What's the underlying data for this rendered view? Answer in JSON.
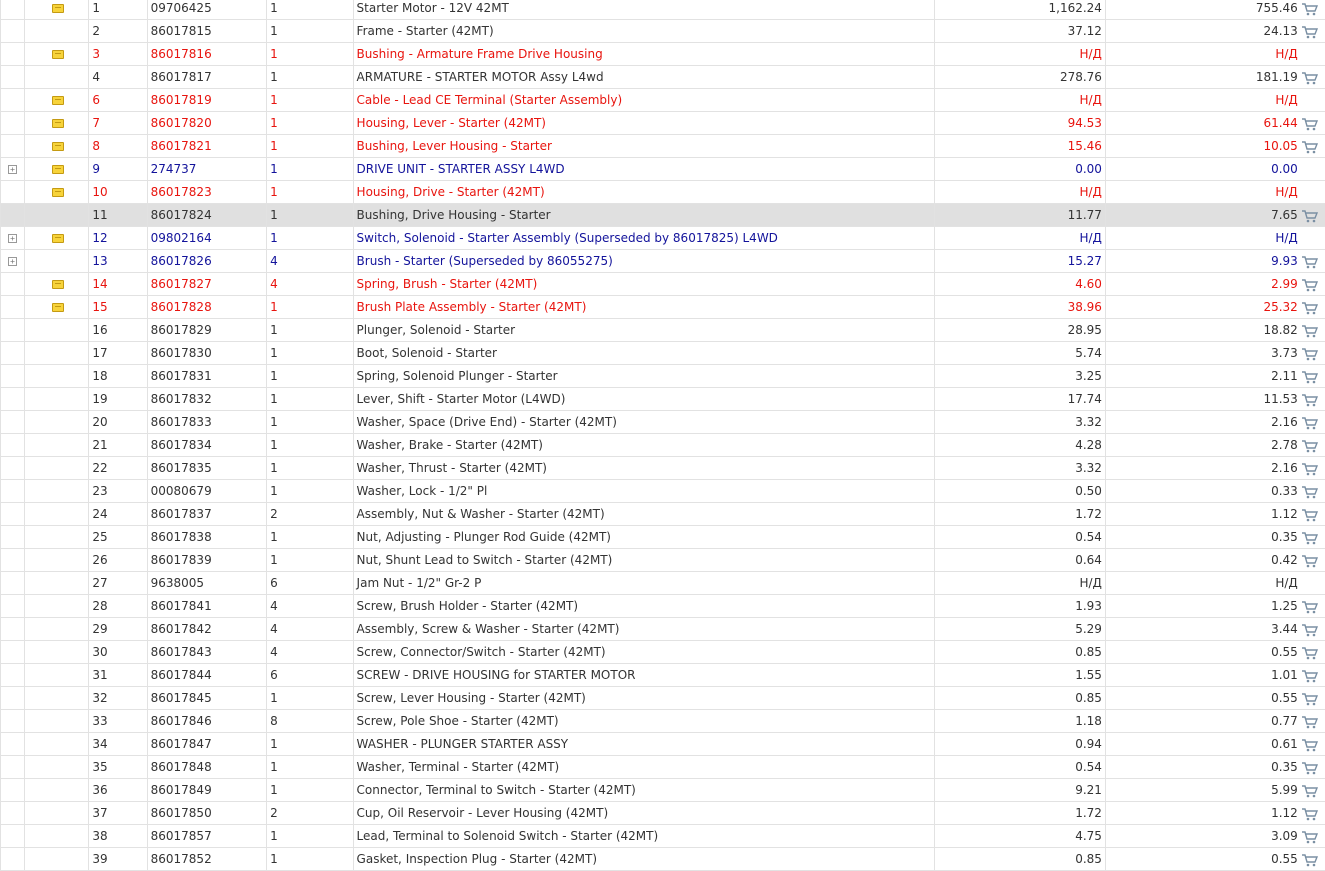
{
  "icons": {
    "note": "note-icon",
    "expand": "expand-plus-icon",
    "cart": "cart-icon"
  },
  "colors": {
    "red": "#e8140e",
    "blue": "#13139b",
    "highlight": "#e0e0e0"
  },
  "rows": [
    {
      "num": "1",
      "code": "09706425",
      "qty": "1",
      "desc": "Starter Motor - 12V 42MT",
      "price1": "1,162.24",
      "price2": "755.46",
      "note": true,
      "expand": false,
      "cart": true,
      "style": ""
    },
    {
      "num": "2",
      "code": "86017815",
      "qty": "1",
      "desc": "Frame - Starter (42MT)",
      "price1": "37.12",
      "price2": "24.13",
      "note": false,
      "expand": false,
      "cart": true,
      "style": ""
    },
    {
      "num": "3",
      "code": "86017816",
      "qty": "1",
      "desc": "Bushing - Armature Frame Drive Housing",
      "price1": "Н/Д",
      "price2": "Н/Д",
      "note": true,
      "expand": false,
      "cart": false,
      "style": "red"
    },
    {
      "num": "4",
      "code": "86017817",
      "qty": "1",
      "desc": "ARMATURE - STARTER MOTOR Assy L4wd",
      "price1": "278.76",
      "price2": "181.19",
      "note": false,
      "expand": false,
      "cart": true,
      "style": ""
    },
    {
      "num": "6",
      "code": "86017819",
      "qty": "1",
      "desc": "Cable - Lead CE Terminal (Starter Assembly)",
      "price1": "Н/Д",
      "price2": "Н/Д",
      "note": true,
      "expand": false,
      "cart": false,
      "style": "red"
    },
    {
      "num": "7",
      "code": "86017820",
      "qty": "1",
      "desc": "Housing, Lever - Starter (42MT)",
      "price1": "94.53",
      "price2": "61.44",
      "note": true,
      "expand": false,
      "cart": true,
      "style": "red"
    },
    {
      "num": "8",
      "code": "86017821",
      "qty": "1",
      "desc": "Bushing, Lever Housing - Starter",
      "price1": "15.46",
      "price2": "10.05",
      "note": true,
      "expand": false,
      "cart": true,
      "style": "red"
    },
    {
      "num": "9",
      "code": "274737",
      "qty": "1",
      "desc": "DRIVE UNIT - STARTER ASSY L4WD",
      "price1": "0.00",
      "price2": "0.00",
      "note": true,
      "expand": true,
      "cart": false,
      "style": "blue"
    },
    {
      "num": "10",
      "code": "86017823",
      "qty": "1",
      "desc": "Housing, Drive - Starter (42MT)",
      "price1": "Н/Д",
      "price2": "Н/Д",
      "note": true,
      "expand": false,
      "cart": false,
      "style": "red"
    },
    {
      "num": "11",
      "code": "86017824",
      "qty": "1",
      "desc": "Bushing, Drive Housing - Starter",
      "price1": "11.77",
      "price2": "7.65",
      "note": false,
      "expand": false,
      "cart": true,
      "style": "hl"
    },
    {
      "num": "12",
      "code": "09802164",
      "qty": "1",
      "desc": "Switch, Solenoid - Starter Assembly (Superseded by 86017825) L4WD",
      "price1": "Н/Д",
      "price2": "Н/Д",
      "note": true,
      "expand": true,
      "cart": false,
      "style": "blue"
    },
    {
      "num": "13",
      "code": "86017826",
      "qty": "4",
      "desc": "Brush - Starter (Superseded by 86055275)",
      "price1": "15.27",
      "price2": "9.93",
      "note": false,
      "expand": true,
      "cart": true,
      "style": "blue"
    },
    {
      "num": "14",
      "code": "86017827",
      "qty": "4",
      "desc": "Spring, Brush - Starter (42MT)",
      "price1": "4.60",
      "price2": "2.99",
      "note": true,
      "expand": false,
      "cart": true,
      "style": "red"
    },
    {
      "num": "15",
      "code": "86017828",
      "qty": "1",
      "desc": "Brush Plate Assembly - Starter (42MT)",
      "price1": "38.96",
      "price2": "25.32",
      "note": true,
      "expand": false,
      "cart": true,
      "style": "red"
    },
    {
      "num": "16",
      "code": "86017829",
      "qty": "1",
      "desc": "Plunger, Solenoid - Starter",
      "price1": "28.95",
      "price2": "18.82",
      "note": false,
      "expand": false,
      "cart": true,
      "style": ""
    },
    {
      "num": "17",
      "code": "86017830",
      "qty": "1",
      "desc": "Boot, Solenoid - Starter",
      "price1": "5.74",
      "price2": "3.73",
      "note": false,
      "expand": false,
      "cart": true,
      "style": ""
    },
    {
      "num": "18",
      "code": "86017831",
      "qty": "1",
      "desc": "Spring, Solenoid Plunger - Starter",
      "price1": "3.25",
      "price2": "2.11",
      "note": false,
      "expand": false,
      "cart": true,
      "style": ""
    },
    {
      "num": "19",
      "code": "86017832",
      "qty": "1",
      "desc": "Lever, Shift - Starter Motor (L4WD)",
      "price1": "17.74",
      "price2": "11.53",
      "note": false,
      "expand": false,
      "cart": true,
      "style": ""
    },
    {
      "num": "20",
      "code": "86017833",
      "qty": "1",
      "desc": "Washer, Space (Drive End) - Starter (42MT)",
      "price1": "3.32",
      "price2": "2.16",
      "note": false,
      "expand": false,
      "cart": true,
      "style": ""
    },
    {
      "num": "21",
      "code": "86017834",
      "qty": "1",
      "desc": "Washer, Brake - Starter (42MT)",
      "price1": "4.28",
      "price2": "2.78",
      "note": false,
      "expand": false,
      "cart": true,
      "style": ""
    },
    {
      "num": "22",
      "code": "86017835",
      "qty": "1",
      "desc": "Washer, Thrust - Starter (42MT)",
      "price1": "3.32",
      "price2": "2.16",
      "note": false,
      "expand": false,
      "cart": true,
      "style": ""
    },
    {
      "num": "23",
      "code": "00080679",
      "qty": "1",
      "desc": "Washer, Lock - 1/2\" Pl",
      "price1": "0.50",
      "price2": "0.33",
      "note": false,
      "expand": false,
      "cart": true,
      "style": ""
    },
    {
      "num": "24",
      "code": "86017837",
      "qty": "2",
      "desc": "Assembly, Nut & Washer - Starter (42MT)",
      "price1": "1.72",
      "price2": "1.12",
      "note": false,
      "expand": false,
      "cart": true,
      "style": ""
    },
    {
      "num": "25",
      "code": "86017838",
      "qty": "1",
      "desc": "Nut, Adjusting - Plunger Rod Guide (42MT)",
      "price1": "0.54",
      "price2": "0.35",
      "note": false,
      "expand": false,
      "cart": true,
      "style": ""
    },
    {
      "num": "26",
      "code": "86017839",
      "qty": "1",
      "desc": "Nut, Shunt Lead to Switch - Starter (42MT)",
      "price1": "0.64",
      "price2": "0.42",
      "note": false,
      "expand": false,
      "cart": true,
      "style": ""
    },
    {
      "num": "27",
      "code": "9638005",
      "qty": "6",
      "desc": "Jam Nut - 1/2\" Gr-2 P",
      "price1": "Н/Д",
      "price2": "Н/Д",
      "note": false,
      "expand": false,
      "cart": false,
      "style": ""
    },
    {
      "num": "28",
      "code": "86017841",
      "qty": "4",
      "desc": "Screw, Brush Holder - Starter (42MT)",
      "price1": "1.93",
      "price2": "1.25",
      "note": false,
      "expand": false,
      "cart": true,
      "style": ""
    },
    {
      "num": "29",
      "code": "86017842",
      "qty": "4",
      "desc": "Assembly, Screw & Washer - Starter (42MT)",
      "price1": "5.29",
      "price2": "3.44",
      "note": false,
      "expand": false,
      "cart": true,
      "style": ""
    },
    {
      "num": "30",
      "code": "86017843",
      "qty": "4",
      "desc": "Screw, Connector/Switch - Starter (42MT)",
      "price1": "0.85",
      "price2": "0.55",
      "note": false,
      "expand": false,
      "cart": true,
      "style": ""
    },
    {
      "num": "31",
      "code": "86017844",
      "qty": "6",
      "desc": "SCREW - DRIVE HOUSING for STARTER MOTOR",
      "price1": "1.55",
      "price2": "1.01",
      "note": false,
      "expand": false,
      "cart": true,
      "style": ""
    },
    {
      "num": "32",
      "code": "86017845",
      "qty": "1",
      "desc": "Screw, Lever Housing - Starter (42MT)",
      "price1": "0.85",
      "price2": "0.55",
      "note": false,
      "expand": false,
      "cart": true,
      "style": ""
    },
    {
      "num": "33",
      "code": "86017846",
      "qty": "8",
      "desc": "Screw, Pole Shoe - Starter (42MT)",
      "price1": "1.18",
      "price2": "0.77",
      "note": false,
      "expand": false,
      "cart": true,
      "style": ""
    },
    {
      "num": "34",
      "code": "86017847",
      "qty": "1",
      "desc": "WASHER - PLUNGER STARTER ASSY",
      "price1": "0.94",
      "price2": "0.61",
      "note": false,
      "expand": false,
      "cart": true,
      "style": ""
    },
    {
      "num": "35",
      "code": "86017848",
      "qty": "1",
      "desc": "Washer, Terminal - Starter (42MT)",
      "price1": "0.54",
      "price2": "0.35",
      "note": false,
      "expand": false,
      "cart": true,
      "style": ""
    },
    {
      "num": "36",
      "code": "86017849",
      "qty": "1",
      "desc": "Connector, Terminal to Switch - Starter (42MT)",
      "price1": "9.21",
      "price2": "5.99",
      "note": false,
      "expand": false,
      "cart": true,
      "style": ""
    },
    {
      "num": "37",
      "code": "86017850",
      "qty": "2",
      "desc": "Cup, Oil Reservoir - Lever Housing (42MT)",
      "price1": "1.72",
      "price2": "1.12",
      "note": false,
      "expand": false,
      "cart": true,
      "style": ""
    },
    {
      "num": "38",
      "code": "86017857",
      "qty": "1",
      "desc": "Lead, Terminal to Solenoid Switch - Starter (42MT)",
      "price1": "4.75",
      "price2": "3.09",
      "note": false,
      "expand": false,
      "cart": true,
      "style": ""
    },
    {
      "num": "39",
      "code": "86017852",
      "qty": "1",
      "desc": "Gasket, Inspection Plug - Starter (42MT)",
      "price1": "0.85",
      "price2": "0.55",
      "note": false,
      "expand": false,
      "cart": true,
      "style": ""
    }
  ]
}
